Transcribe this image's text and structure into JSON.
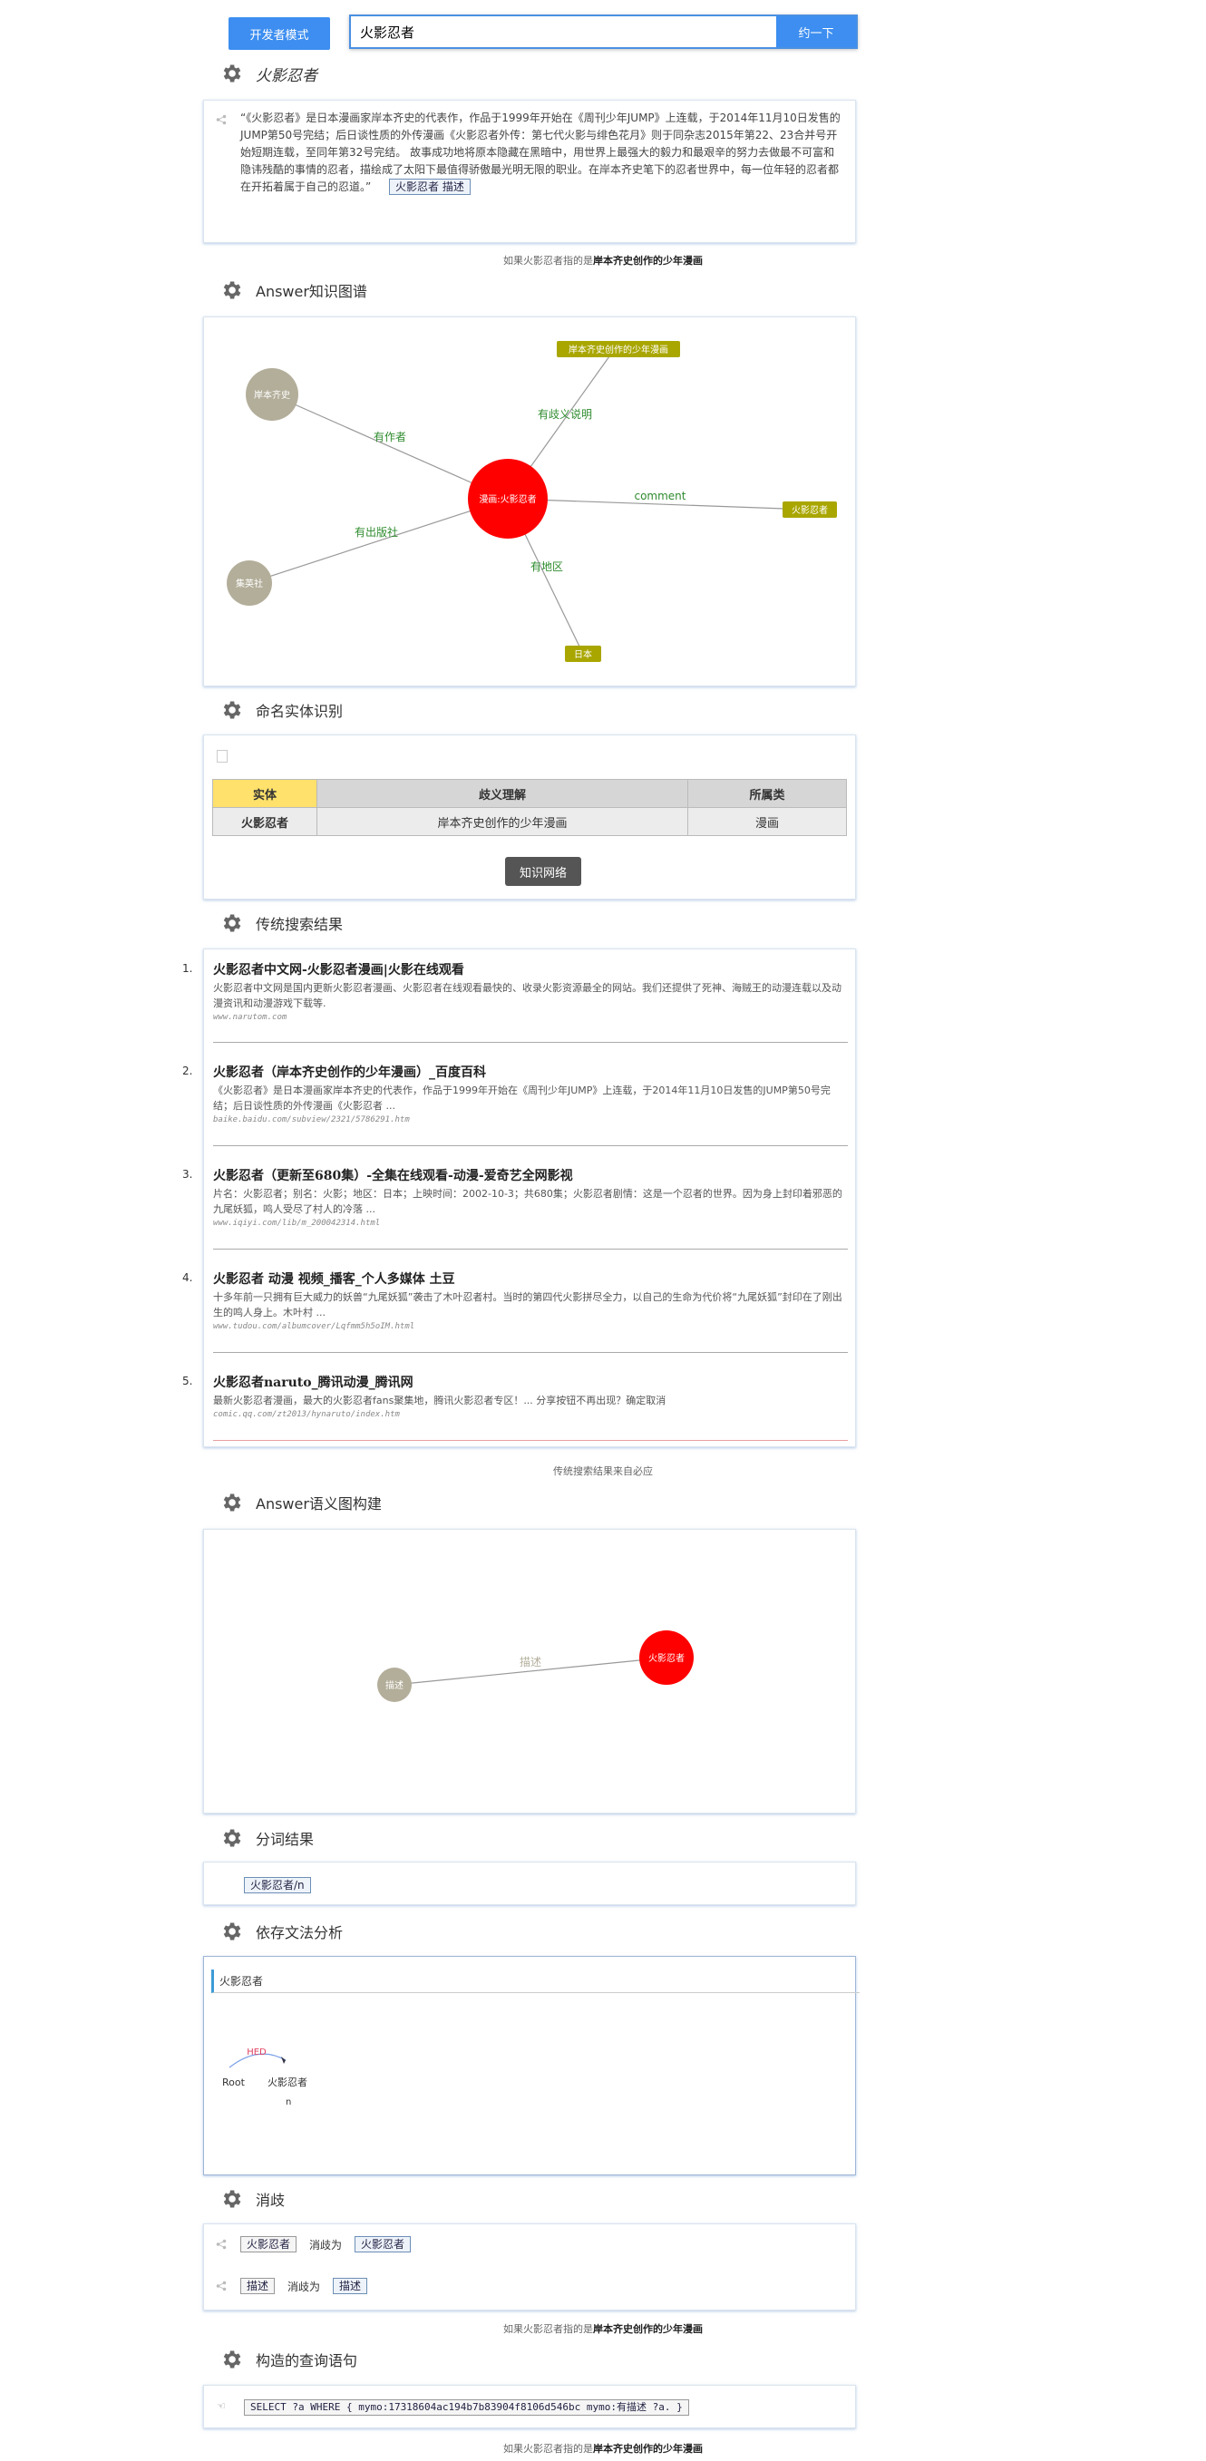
{
  "header": {
    "dev_mode_label": "开发者模式",
    "search_value": "火影忍者",
    "search_button": "约一下"
  },
  "title_section": {
    "title": "火影忍者",
    "description": "“《火影忍者》是日本漫画家岸本齐史的代表作，作品于1999年开始在《周刊少年JUMP》上连载，于2014年11月10日发售的JUMP第50号完结；后日谈性质的外传漫画《火影忍者外传：第七代火影与绯色花月》则于同杂志2015年第22、23合并号开始短期连载，至同年第32号完结。 故事成功地将原本隐藏在黑暗中，用世界上最强大的毅力和最艰辛的努力去做最不可富和隐讳残酷的事情的忍者，描绘成了太阳下最值得骄傲最光明无限的职业。在岸本齐史笔下的忍者世界中，每一位年轻的忍者都在开拓着属于自己的忍道。”",
    "tag": "火影忍者 描述"
  },
  "caption1": {
    "prefix": "如果火影忍者指的是",
    "bold": "岸本齐史创作的少年漫画"
  },
  "kg_section": {
    "title": "Answer知识图谱",
    "center": "漫画:火影忍者",
    "nodes": {
      "author": "岸本齐史",
      "publisher": "集英社",
      "desc": "岸本齐史创作的少年漫画",
      "comment": "火影忍者",
      "region": "日本"
    },
    "edges": {
      "author": "有作者",
      "publisher": "有出版社",
      "desc": "有歧义说明",
      "comment": "comment",
      "region": "有地区"
    }
  },
  "ner_section": {
    "title": "命名实体识别",
    "headers": [
      "实体",
      "歧义理解",
      "所属类"
    ],
    "rows": [
      [
        "火影忍者",
        "岸本齐史创作的少年漫画",
        "漫画"
      ]
    ],
    "button": "知识网络"
  },
  "search_section": {
    "title": "传统搜索结果",
    "results": [
      {
        "num": "1.",
        "title": "火影忍者中文网-火影忍者漫画|火影在线观看",
        "snippet": "火影忍者中文网是国内更新火影忍者漫画、火影忍者在线观看最快的、收录火影资源最全的网站。我们还提供了死神、海贼王的动漫连载以及动漫资讯和动漫游戏下载等.",
        "url": "www.narutom.com"
      },
      {
        "num": "2.",
        "title": "火影忍者（岸本齐史创作的少年漫画）_百度百科",
        "snippet": "《火影忍者》是日本漫画家岸本齐史的代表作，作品于1999年开始在《周刊少年JUMP》上连载，于2014年11月10日发售的JUMP第50号完结；后日谈性质的外传漫画《火影忍者 ...",
        "url": "baike.baidu.com/subview/2321/5786291.htm"
      },
      {
        "num": "3.",
        "title": "火影忍者（更新至680集）-全集在线观看-动漫-爱奇艺全网影视",
        "snippet": "片名：火影忍者；别名：火影；地区：日本；上映时间：2002-10-3；共680集；火影忍者剧情：这是一个忍者的世界。因为身上封印着邪恶的九尾妖狐，鸣人受尽了村人的冷落 ...",
        "url": "www.iqiyi.com/lib/m_200042314.html"
      },
      {
        "num": "4.",
        "title": "火影忍者 动漫 视频_播客_个人多媒体 土豆",
        "snippet": "十多年前一只拥有巨大威力的妖兽“九尾妖狐”袭击了木叶忍者村。当时的第四代火影拼尽全力，以自己的生命为代价将“九尾妖狐”封印在了刚出生的鸣人身上。木叶村 ...",
        "url": "www.tudou.com/albumcover/Lqfmm5h5oIM.html"
      },
      {
        "num": "5.",
        "title": "火影忍者naruto_腾讯动漫_腾讯网",
        "snippet": "最新火影忍者漫画，最大的火影忍者fans聚集地，腾讯火影忍者专区！... 分享按钮不再出现？确定取消",
        "url": "comic.qq.com/zt2013/hynaruto/index.htm"
      }
    ],
    "caption": "传统搜索结果来自必应"
  },
  "semantic_section": {
    "title": "Answer语义图构建",
    "left_node": "描述",
    "right_node": "火影忍者",
    "edge": "描述"
  },
  "seg_section": {
    "title": "分词结果",
    "token": "火影忍者/n"
  },
  "dep_section": {
    "title": "依存文法分析",
    "sentence": "火影忍者",
    "root": "Root",
    "word": "火影忍者",
    "pos": "n",
    "arc": "HED"
  },
  "disamb_section": {
    "title": "消歧",
    "rows": [
      {
        "src": "火影忍者",
        "verb": "消歧为",
        "dst": "火影忍者"
      },
      {
        "src": "描述",
        "verb": "消歧为",
        "dst": "描述"
      }
    ]
  },
  "caption2": {
    "prefix": "如果火影忍者指的是",
    "bold": "岸本齐史创作的少年漫画"
  },
  "query_section": {
    "title": "构造的查询语句",
    "query": "SELECT ?a WHERE { mymo:17318604ac194b7b83904f8106d546bc mymo:有描述 ?a. }"
  },
  "caption3": {
    "prefix": "如果火影忍者指的是",
    "bold": "岸本齐史创作的少年漫画"
  },
  "colors": {
    "accent": "#3d8ef0",
    "center_node": "#ff0000",
    "grey_node": "#b3ae9a",
    "olive_node": "#a9a600",
    "edge_green": "#2e8b2e"
  }
}
